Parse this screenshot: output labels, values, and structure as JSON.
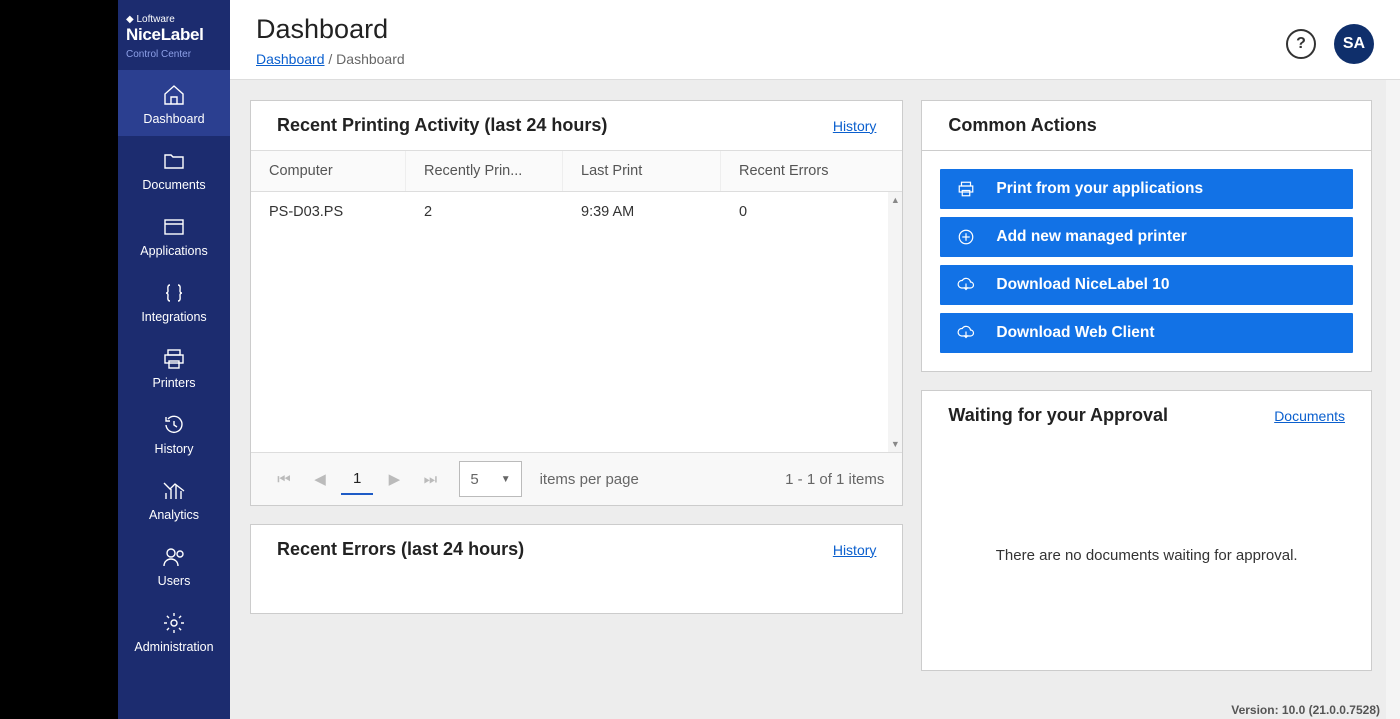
{
  "brand": {
    "top": "◆ Loftware",
    "main": "NiceLabel",
    "sub": "Control Center"
  },
  "sidebar": {
    "items": [
      {
        "label": "Dashboard"
      },
      {
        "label": "Documents"
      },
      {
        "label": "Applications"
      },
      {
        "label": "Integrations"
      },
      {
        "label": "Printers"
      },
      {
        "label": "History"
      },
      {
        "label": "Analytics"
      },
      {
        "label": "Users"
      },
      {
        "label": "Administration"
      }
    ]
  },
  "header": {
    "title": "Dashboard",
    "breadcrumb_root": "Dashboard",
    "breadcrumb_sep": " / ",
    "breadcrumb_leaf": "Dashboard",
    "help": "?",
    "avatar": "SA"
  },
  "recent_activity": {
    "title": "Recent Printing Activity (last 24 hours)",
    "history_link": "History",
    "columns": {
      "computer": "Computer",
      "recently": "Recently Prin...",
      "last": "Last Print",
      "errors": "Recent Errors"
    },
    "rows": [
      {
        "computer": "PS-D03.PS",
        "recently": "2",
        "last": "9:39 AM",
        "errors": "0"
      }
    ],
    "pager": {
      "page": "1",
      "page_size": "5",
      "items_label": "items per page",
      "count_text": "1 - 1 of 1 items"
    }
  },
  "recent_errors": {
    "title": "Recent Errors (last 24 hours)",
    "history_link": "History"
  },
  "common_actions": {
    "title": "Common Actions",
    "items": [
      {
        "label": "Print from your applications"
      },
      {
        "label": "Add new managed printer"
      },
      {
        "label": "Download NiceLabel 10"
      },
      {
        "label": "Download Web Client"
      }
    ]
  },
  "approval": {
    "title": "Waiting for your Approval",
    "link": "Documents",
    "empty": "There are no documents waiting for approval."
  },
  "version": "Version: 10.0 (21.0.0.7528)"
}
